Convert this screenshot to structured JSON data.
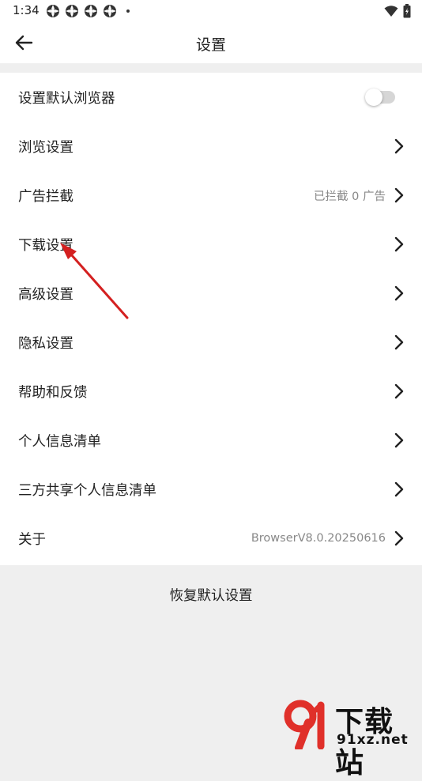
{
  "status_bar": {
    "time": "1:34"
  },
  "header": {
    "title": "设置"
  },
  "settings": {
    "default_browser": {
      "label": "设置默认浏览器",
      "toggle_on": false
    },
    "browse": {
      "label": "浏览设置"
    },
    "ad_block": {
      "label": "广告拦截",
      "value": "已拦截 0 广告"
    },
    "download": {
      "label": "下载设置"
    },
    "advanced": {
      "label": "高级设置"
    },
    "privacy": {
      "label": "隐私设置"
    },
    "help": {
      "label": "帮助和反馈"
    },
    "personal_info": {
      "label": "个人信息清单"
    },
    "third_party_info": {
      "label": "三方共享个人信息清单"
    },
    "about": {
      "label": "关于",
      "value": "BrowserV8.0.20250616"
    }
  },
  "restore_button": {
    "label": "恢复默认设置"
  },
  "watermark": {
    "title": "下载站",
    "domain": "91xz.net"
  },
  "colors": {
    "annotation_arrow": "#d42020",
    "watermark_red": "#e0302a",
    "background": "#efefef"
  }
}
